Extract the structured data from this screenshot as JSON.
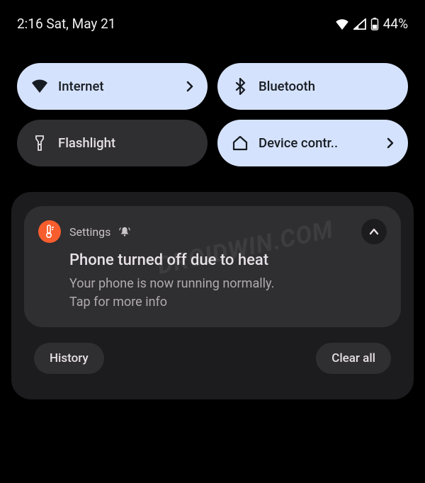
{
  "status": {
    "time_date": "2:16 Sat, May 21",
    "battery_pct": "44%"
  },
  "tiles": {
    "internet": "Internet",
    "bluetooth": "Bluetooth",
    "flashlight": "Flashlight",
    "device_controls": "Device contr.."
  },
  "notification": {
    "app": "Settings",
    "title": "Phone turned off due to heat",
    "line1": "Your phone is now running normally.",
    "line2": "Tap for more info"
  },
  "actions": {
    "history": "History",
    "clear_all": "Clear all"
  },
  "watermark": "DROIDWIN.COM"
}
